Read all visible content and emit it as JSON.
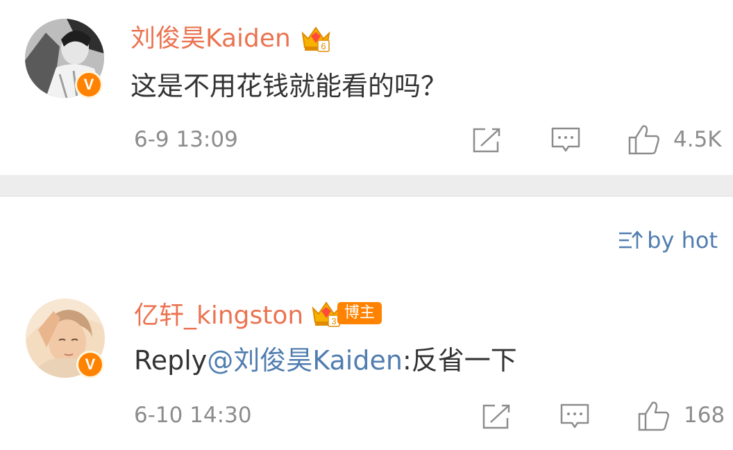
{
  "comment": {
    "username": "刘俊昊Kaiden",
    "level_badge": "crown-level-6",
    "text": "这是不用花钱就能看的吗？",
    "timestamp": "6-9 13:09",
    "like_count": "4.5K",
    "verified_badge": "V"
  },
  "sort": {
    "label": "by hot",
    "icon": "sort-icon"
  },
  "reply": {
    "username": "亿轩_kingston",
    "level_badge": "crown-level-3",
    "host_badge": "博主",
    "prefix": "Reply",
    "mention": "@刘俊昊Kaiden",
    "text": ":反省一下",
    "timestamp": "6-10 14:30",
    "like_count": "168",
    "verified_badge": "V"
  },
  "colors": {
    "username": "#eb7350",
    "link": "#507daf",
    "meta": "#8c8c8c",
    "badge": "#ff8200",
    "separator": "#ededed"
  }
}
